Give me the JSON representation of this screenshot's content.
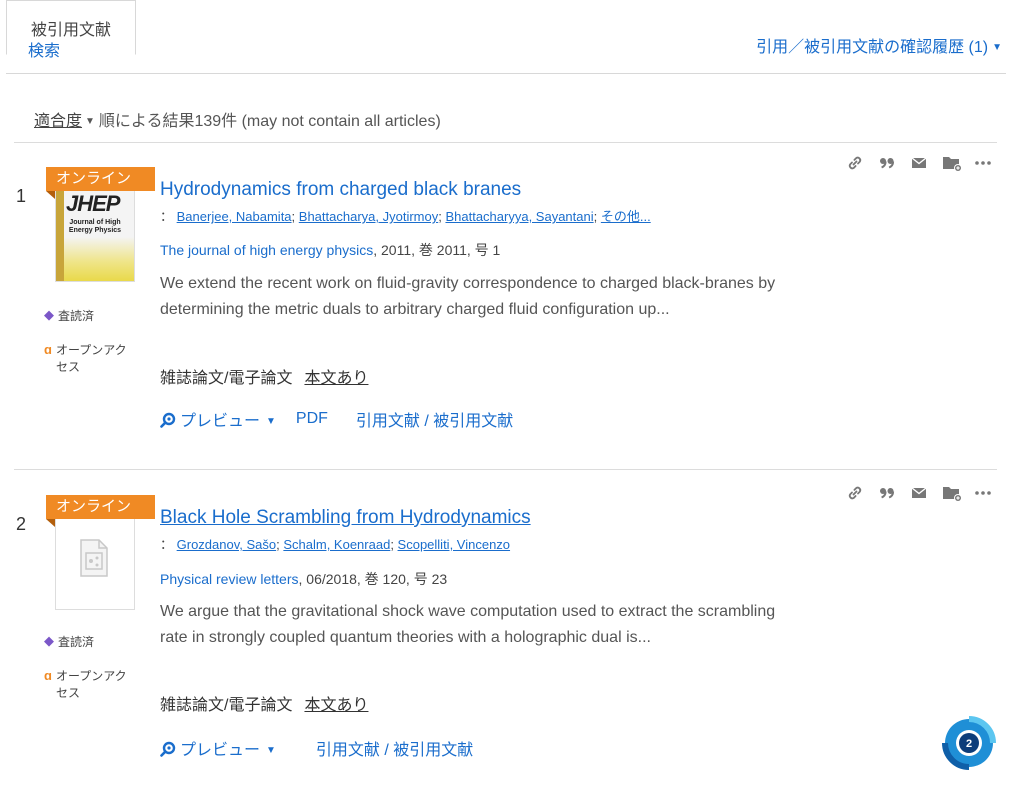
{
  "tabs": {
    "search_label": "検索",
    "cited_label": "被引用文献",
    "history_label": "引用／被引用文献の確認履歴 (1)"
  },
  "sort": {
    "sort_by": "適合度",
    "result_text": "順による結果139件 (may not contain all articles)"
  },
  "results": [
    {
      "number": "1",
      "ribbon": "オンライン",
      "thumbnail": {
        "title": "JHEP",
        "subtitle": "Journal of High Energy Physics"
      },
      "peer_reviewed": "査読済",
      "open_access": "オープンアクセス",
      "title": "Hydrodynamics from charged black branes",
      "author_prefix": "：",
      "authors": [
        "Banerjee, Nabamita",
        "Bhattacharya, Jyotirmoy",
        "Bhattacharyya, Sayantani",
        "その他..."
      ],
      "journal_name": "The journal of high energy physics",
      "journal_info": ", 2011, 巻 2011, 号 1",
      "abstract": "We extend the recent work on fluid-gravity correspondence to charged black-branes by determining the metric duals to arbitrary charged fluid configuration up...",
      "doc_type": "雑誌論文/電子論文",
      "fulltext": "本文あり",
      "preview_label": "プレビュー",
      "pdf_label": "PDF",
      "cite_label": "引用文献 / 被引用文献"
    },
    {
      "number": "2",
      "ribbon": "オンライン",
      "peer_reviewed": "査読済",
      "open_access": "オープンアクセス",
      "title": "Black Hole Scrambling from Hydrodynamics",
      "author_prefix": "：",
      "authors": [
        "Grozdanov, Sašo",
        "Schalm, Koenraad",
        "Scopelliti, Vincenzo"
      ],
      "journal_name": "Physical review letters",
      "journal_info": ", 06/2018, 巻 120, 号 23",
      "abstract": "We argue that the gravitational shock wave computation used to extract the scrambling rate in strongly coupled quantum theories with a holographic dual is...",
      "doc_type": "雑誌論文/電子論文",
      "fulltext": "本文あり",
      "preview_label": "プレビュー",
      "cite_label": "引用文献 / 被引用文献"
    }
  ],
  "icons": {
    "link": "link-icon",
    "quote": "quote-icon",
    "email": "email-icon",
    "folder": "folder-add-icon",
    "more": "more-icon"
  },
  "floating_badge": {
    "count": "2"
  },
  "colors": {
    "link": "#1a6dcc",
    "ribbon": "#f08a24",
    "peer": "#7b57c8"
  }
}
